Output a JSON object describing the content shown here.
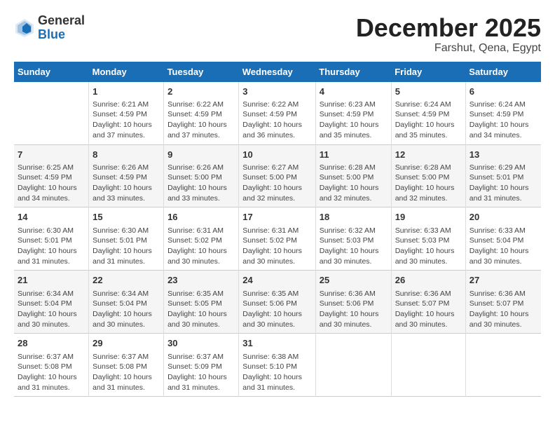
{
  "logo": {
    "general": "General",
    "blue": "Blue"
  },
  "title": "December 2025",
  "location": "Farshut, Qena, Egypt",
  "days_header": [
    "Sunday",
    "Monday",
    "Tuesday",
    "Wednesday",
    "Thursday",
    "Friday",
    "Saturday"
  ],
  "weeks": [
    [
      {
        "num": "",
        "info": ""
      },
      {
        "num": "1",
        "info": "Sunrise: 6:21 AM\nSunset: 4:59 PM\nDaylight: 10 hours\nand 37 minutes."
      },
      {
        "num": "2",
        "info": "Sunrise: 6:22 AM\nSunset: 4:59 PM\nDaylight: 10 hours\nand 37 minutes."
      },
      {
        "num": "3",
        "info": "Sunrise: 6:22 AM\nSunset: 4:59 PM\nDaylight: 10 hours\nand 36 minutes."
      },
      {
        "num": "4",
        "info": "Sunrise: 6:23 AM\nSunset: 4:59 PM\nDaylight: 10 hours\nand 35 minutes."
      },
      {
        "num": "5",
        "info": "Sunrise: 6:24 AM\nSunset: 4:59 PM\nDaylight: 10 hours\nand 35 minutes."
      },
      {
        "num": "6",
        "info": "Sunrise: 6:24 AM\nSunset: 4:59 PM\nDaylight: 10 hours\nand 34 minutes."
      }
    ],
    [
      {
        "num": "7",
        "info": "Sunrise: 6:25 AM\nSunset: 4:59 PM\nDaylight: 10 hours\nand 34 minutes."
      },
      {
        "num": "8",
        "info": "Sunrise: 6:26 AM\nSunset: 4:59 PM\nDaylight: 10 hours\nand 33 minutes."
      },
      {
        "num": "9",
        "info": "Sunrise: 6:26 AM\nSunset: 5:00 PM\nDaylight: 10 hours\nand 33 minutes."
      },
      {
        "num": "10",
        "info": "Sunrise: 6:27 AM\nSunset: 5:00 PM\nDaylight: 10 hours\nand 32 minutes."
      },
      {
        "num": "11",
        "info": "Sunrise: 6:28 AM\nSunset: 5:00 PM\nDaylight: 10 hours\nand 32 minutes."
      },
      {
        "num": "12",
        "info": "Sunrise: 6:28 AM\nSunset: 5:00 PM\nDaylight: 10 hours\nand 32 minutes."
      },
      {
        "num": "13",
        "info": "Sunrise: 6:29 AM\nSunset: 5:01 PM\nDaylight: 10 hours\nand 31 minutes."
      }
    ],
    [
      {
        "num": "14",
        "info": "Sunrise: 6:30 AM\nSunset: 5:01 PM\nDaylight: 10 hours\nand 31 minutes."
      },
      {
        "num": "15",
        "info": "Sunrise: 6:30 AM\nSunset: 5:01 PM\nDaylight: 10 hours\nand 31 minutes."
      },
      {
        "num": "16",
        "info": "Sunrise: 6:31 AM\nSunset: 5:02 PM\nDaylight: 10 hours\nand 30 minutes."
      },
      {
        "num": "17",
        "info": "Sunrise: 6:31 AM\nSunset: 5:02 PM\nDaylight: 10 hours\nand 30 minutes."
      },
      {
        "num": "18",
        "info": "Sunrise: 6:32 AM\nSunset: 5:03 PM\nDaylight: 10 hours\nand 30 minutes."
      },
      {
        "num": "19",
        "info": "Sunrise: 6:33 AM\nSunset: 5:03 PM\nDaylight: 10 hours\nand 30 minutes."
      },
      {
        "num": "20",
        "info": "Sunrise: 6:33 AM\nSunset: 5:04 PM\nDaylight: 10 hours\nand 30 minutes."
      }
    ],
    [
      {
        "num": "21",
        "info": "Sunrise: 6:34 AM\nSunset: 5:04 PM\nDaylight: 10 hours\nand 30 minutes."
      },
      {
        "num": "22",
        "info": "Sunrise: 6:34 AM\nSunset: 5:04 PM\nDaylight: 10 hours\nand 30 minutes."
      },
      {
        "num": "23",
        "info": "Sunrise: 6:35 AM\nSunset: 5:05 PM\nDaylight: 10 hours\nand 30 minutes."
      },
      {
        "num": "24",
        "info": "Sunrise: 6:35 AM\nSunset: 5:06 PM\nDaylight: 10 hours\nand 30 minutes."
      },
      {
        "num": "25",
        "info": "Sunrise: 6:36 AM\nSunset: 5:06 PM\nDaylight: 10 hours\nand 30 minutes."
      },
      {
        "num": "26",
        "info": "Sunrise: 6:36 AM\nSunset: 5:07 PM\nDaylight: 10 hours\nand 30 minutes."
      },
      {
        "num": "27",
        "info": "Sunrise: 6:36 AM\nSunset: 5:07 PM\nDaylight: 10 hours\nand 30 minutes."
      }
    ],
    [
      {
        "num": "28",
        "info": "Sunrise: 6:37 AM\nSunset: 5:08 PM\nDaylight: 10 hours\nand 31 minutes."
      },
      {
        "num": "29",
        "info": "Sunrise: 6:37 AM\nSunset: 5:08 PM\nDaylight: 10 hours\nand 31 minutes."
      },
      {
        "num": "30",
        "info": "Sunrise: 6:37 AM\nSunset: 5:09 PM\nDaylight: 10 hours\nand 31 minutes."
      },
      {
        "num": "31",
        "info": "Sunrise: 6:38 AM\nSunset: 5:10 PM\nDaylight: 10 hours\nand 31 minutes."
      },
      {
        "num": "",
        "info": ""
      },
      {
        "num": "",
        "info": ""
      },
      {
        "num": "",
        "info": ""
      }
    ]
  ]
}
